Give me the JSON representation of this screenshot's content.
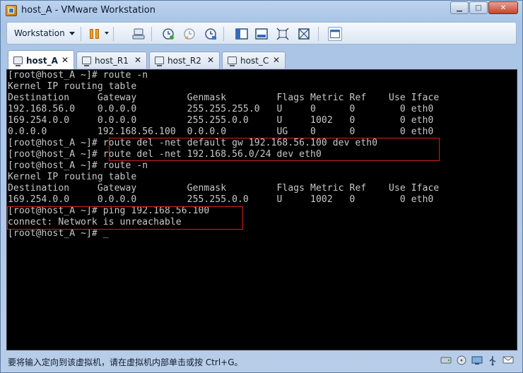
{
  "window": {
    "title": "host_A - VMware Workstation",
    "controls": {
      "minimize": "▁",
      "maximize": "□",
      "close": "✕"
    }
  },
  "toolbar": {
    "menu_label": "Workstation",
    "icons": [
      "pause-icon",
      "send-keys-icon",
      "snapshot-icon",
      "revert-snapshot-icon",
      "snapshot-manager-icon",
      "sidebar-icon",
      "console-view-icon",
      "fullscreen-icon",
      "unity-icon",
      "library-icon"
    ]
  },
  "tabs": [
    {
      "label": "host_A",
      "close": "✕",
      "active": true
    },
    {
      "label": "host_R1",
      "close": "✕",
      "active": false
    },
    {
      "label": "host_R2",
      "close": "✕",
      "active": false
    },
    {
      "label": "host_C",
      "close": "✕",
      "active": false
    }
  ],
  "terminal": {
    "lines": [
      "[root@host_A ~]# route -n",
      "Kernel IP routing table",
      "Destination     Gateway         Genmask         Flags Metric Ref    Use Iface",
      "192.168.56.0    0.0.0.0         255.255.255.0   U     0      0        0 eth0",
      "169.254.0.0     0.0.0.0         255.255.0.0     U     1002   0        0 eth0",
      "0.0.0.0         192.168.56.100  0.0.0.0         UG    0      0        0 eth0",
      "[root@host_A ~]# route del -net default gw 192.168.56.100 dev eth0",
      "[root@host_A ~]# route del -net 192.168.56.0/24 dev eth0",
      "[root@host_A ~]# route -n",
      "Kernel IP routing table",
      "Destination     Gateway         Genmask         Flags Metric Ref    Use Iface",
      "169.254.0.0     0.0.0.0         255.255.0.0     U     1002   0        0 eth0",
      "[root@host_A ~]# ping 192.168.56.100",
      "connect: Network is unreachable",
      "[root@host_A ~]# _"
    ],
    "text_color": "#c8c8c8",
    "background": "#000000",
    "highlight_color": "#d61f1f"
  },
  "statusbar": {
    "text": "要将输入定向到该虚拟机，请在虚拟机内部单击或按 Ctrl+G。",
    "tray_icons": [
      "hard-disk-icon",
      "cd-drive-icon",
      "network-adapter-icon",
      "usb-icon",
      "message-icon"
    ]
  }
}
